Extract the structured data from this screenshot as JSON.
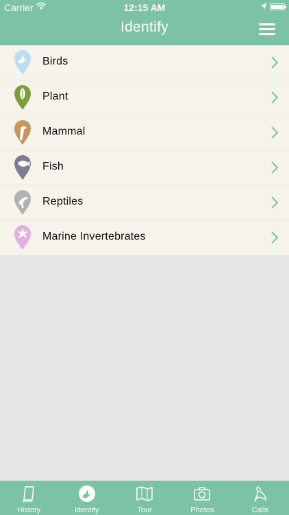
{
  "status": {
    "carrier": "Carrier",
    "time": "12:15 AM"
  },
  "header": {
    "title": "Identify",
    "menu_icon": "hamburger-icon"
  },
  "categories": [
    {
      "label": "Birds",
      "icon": "bird-pin-icon",
      "color": "#bcdcf3"
    },
    {
      "label": "Plant",
      "icon": "leaf-pin-icon",
      "color": "#7a9e3e"
    },
    {
      "label": "Mammal",
      "icon": "mammal-pin-icon",
      "color": "#c9955a"
    },
    {
      "label": "Fish",
      "icon": "fish-pin-icon",
      "color": "#7f7b92"
    },
    {
      "label": "Reptiles",
      "icon": "reptile-pin-icon",
      "color": "#b2b2b2"
    },
    {
      "label": "Marine Invertebrates",
      "icon": "marine-pin-icon",
      "color": "#e2b2de"
    }
  ],
  "tabs": [
    {
      "label": "History",
      "icon": "book-icon"
    },
    {
      "label": "Identify",
      "icon": "identify-icon",
      "active": true
    },
    {
      "label": "Tour",
      "icon": "map-icon"
    },
    {
      "label": "Photos",
      "icon": "camera-icon"
    },
    {
      "label": "Calls",
      "icon": "bird-call-icon"
    }
  ],
  "colors": {
    "accent": "#7cc2a4",
    "row_bg": "#f6f3ea",
    "page_bg": "#e7e7e7",
    "chevron": "#7cc2a4"
  }
}
